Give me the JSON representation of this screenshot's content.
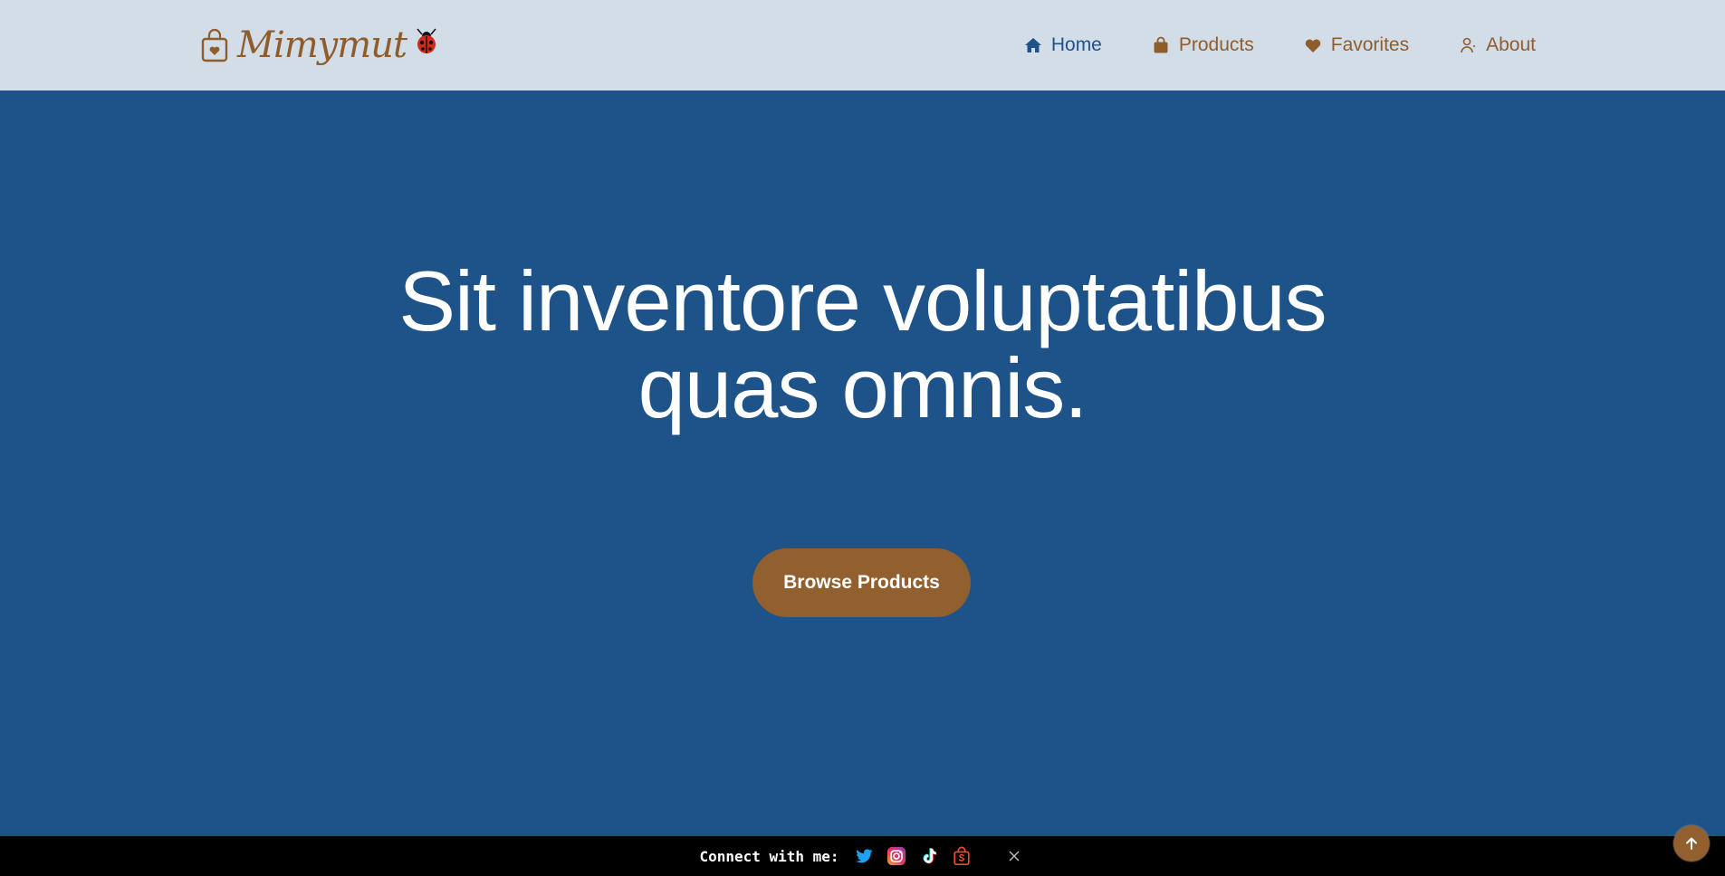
{
  "header": {
    "logo_text": "Mimymut",
    "logo_icon": "shopping-bag-heart-icon",
    "logo_bug_icon": "ladybug-icon",
    "nav": [
      {
        "label": "Home",
        "icon": "home-icon",
        "active": true
      },
      {
        "label": "Products",
        "icon": "shopping-bag-icon",
        "active": false
      },
      {
        "label": "Favorites",
        "icon": "heart-icon",
        "active": false
      },
      {
        "label": "About",
        "icon": "user-icon",
        "active": false
      }
    ]
  },
  "hero": {
    "title_line1": "Sit inventore voluptatibus",
    "title_line2": "quas omnis.",
    "button_label": "Browse Products"
  },
  "social_bar": {
    "text": "Connect with me:",
    "icons": [
      "twitter-icon",
      "instagram-icon",
      "tiktok-icon",
      "shop-icon"
    ],
    "close_icon": "close-icon"
  },
  "back_to_top_icon": "arrow-up-icon",
  "colors": {
    "header_bg": "#d3dde8",
    "hero_bg": "#1e5389",
    "accent": "#925f2e",
    "nav_active": "#1e5389",
    "nav_inactive": "#8f5d2c",
    "bar_bg": "#000000"
  }
}
